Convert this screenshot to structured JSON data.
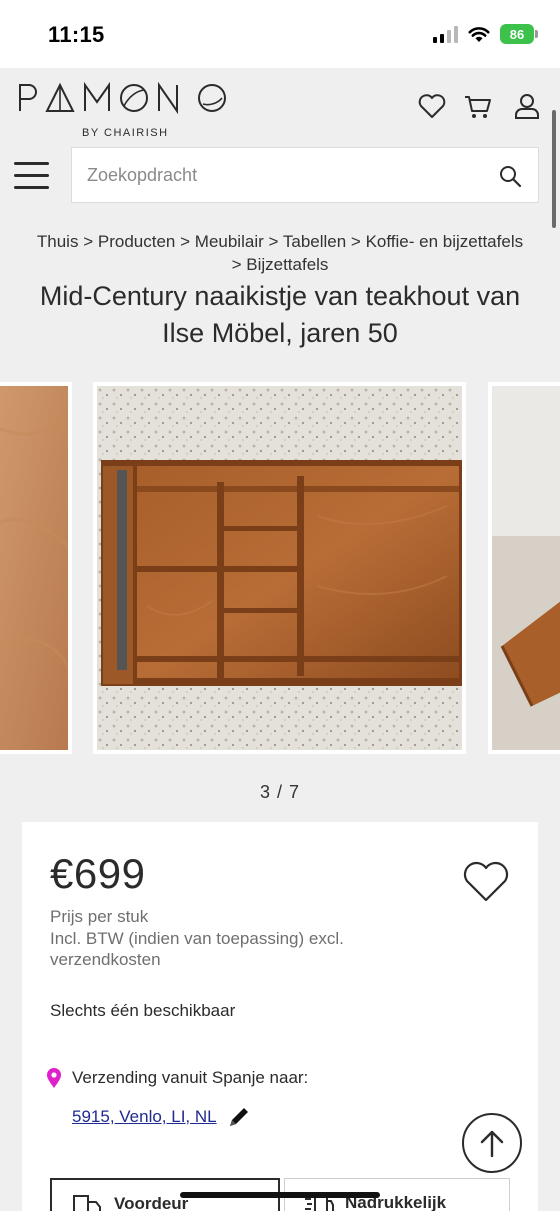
{
  "status_bar": {
    "time": "11:15",
    "battery": "86"
  },
  "header": {
    "logo_text": "PAMONO",
    "logo_sub": "BY CHAIRISH",
    "icons": [
      "heart-icon",
      "cart-icon",
      "user-icon"
    ]
  },
  "search": {
    "placeholder": "Zoekopdracht"
  },
  "breadcrumb": {
    "items": [
      "Thuis",
      "Producten",
      "Meubilair",
      "Tabellen",
      "Koffie- en bijzettafels",
      "Bijzettafels"
    ],
    "separator": ">"
  },
  "product": {
    "title_line1": "Mid-Century naaikistje van teakhout van",
    "title_line2": "Ilse Möbel, jaren 50",
    "gallery_counter": "3 / 7",
    "price": "€699",
    "price_note1": "Prijs per stuk",
    "price_note2": "Incl. BTW (indien van toepassing) excl.",
    "price_note3": "verzendkosten",
    "availability": "Slechts één beschikbaar",
    "shipping_label": "Verzending vanuit Spanje naar:",
    "shipping_location": "5915, Venlo, LI, NL",
    "option_left": "Voordeur",
    "option_right": "Nadrukkelijk"
  },
  "colors": {
    "accent_pin": "#e020c8",
    "link": "#1f2b8f",
    "battery": "#3cc14a"
  }
}
